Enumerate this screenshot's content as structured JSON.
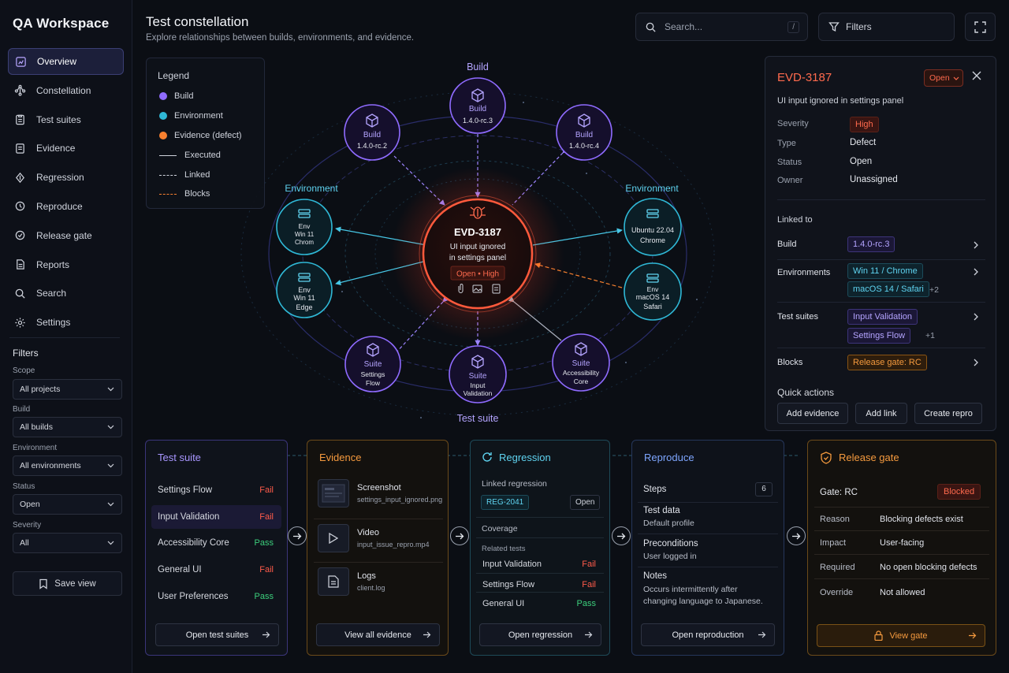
{
  "app": {
    "name": "QA Workspace"
  },
  "nav": [
    {
      "label": "Overview",
      "icon": "chart-square-icon",
      "active": true
    },
    {
      "label": "Constellation",
      "icon": "constellation-icon"
    },
    {
      "label": "Test suites",
      "icon": "clipboard-icon"
    },
    {
      "label": "Evidence",
      "icon": "folder-icon"
    },
    {
      "label": "Regression",
      "icon": "regression-icon"
    },
    {
      "label": "Reproduce",
      "icon": "reproduce-icon"
    },
    {
      "label": "Release gate",
      "icon": "gate-icon"
    },
    {
      "label": "Reports",
      "icon": "report-icon"
    },
    {
      "label": "Search",
      "icon": "search-icon"
    },
    {
      "label": "Settings",
      "icon": "gear-icon"
    }
  ],
  "filters": {
    "title": "Filters",
    "scope": {
      "label": "Scope",
      "value": "All projects"
    },
    "build": {
      "label": "Build",
      "value": "All builds"
    },
    "environment": {
      "label": "Environment",
      "value": "All environments"
    },
    "status": {
      "label": "Status",
      "value": "Open"
    },
    "severity": {
      "label": "Severity",
      "value": "All"
    },
    "save_label": "Save view"
  },
  "header": {
    "title": "Test constellation",
    "subtitle": "Explore relationships between builds, environments, and evidence.",
    "search_placeholder": "Search...",
    "search_shortcut": "/",
    "filters_label": "Filters"
  },
  "legend": {
    "title": "Legend",
    "build": "Build",
    "environment": "Environment",
    "evidence": "Evidence (defect)",
    "executed": "Executed",
    "linked": "Linked",
    "blocks": "Blocks",
    "colors": {
      "build": "#8f6bff",
      "environment": "#2fb8d6",
      "evidence": "#f7802f"
    }
  },
  "graph": {
    "group_labels": {
      "build": "Build",
      "environment_left": "Environment",
      "environment_right": "Environment",
      "suite": "Test suite"
    },
    "center": {
      "id": "EVD-3187",
      "line1": "UI input ignored",
      "line2": "in settings panel",
      "badge": "Open • High"
    },
    "nodes": {
      "build_top": {
        "type": "Build",
        "name": "1.4.0-rc.3"
      },
      "build_left": {
        "type": "Build",
        "name": "1.4.0-rc.2"
      },
      "build_right": {
        "type": "Build",
        "name": "1.4.0-rc.4"
      },
      "env_lt": {
        "line1": "Env",
        "line2": "Win 11",
        "line3": "Chrom"
      },
      "env_lb": {
        "line1": "Env",
        "line2": "Win 11",
        "line3": "Edge"
      },
      "env_rt": {
        "line1": "Ubuntu 22.04",
        "line2": "Chrome"
      },
      "env_rb": {
        "line1": "Env",
        "line2": "macOS 14",
        "line3": "Safari"
      },
      "suite_left": {
        "type": "Suite",
        "line1": "Settings",
        "line2": "Flow"
      },
      "suite_bottom": {
        "type": "Suite",
        "line1": "Input",
        "line2": "Validation"
      },
      "suite_right": {
        "type": "Suite",
        "line1": "Accessibility",
        "line2": "Core"
      }
    }
  },
  "detail": {
    "id": "EVD-3187",
    "status": "Open",
    "description": "UI input ignored in settings panel",
    "severity_label": "Severity",
    "severity": "High",
    "type_label": "Type",
    "type": "Defect",
    "status_label": "Status",
    "status_value": "Open",
    "owner_label": "Owner",
    "owner": "Unassigned",
    "linked_to": "Linked to",
    "build_label": "Build",
    "build": "1.4.0-rc.3",
    "env_label": "Environments",
    "env1": "Win 11 / Chrome",
    "env2": "macOS 14 / Safari",
    "env_more": "+2",
    "suites_label": "Test suites",
    "suite1": "Input Validation",
    "suite2": "Settings Flow",
    "suite_more": "+1",
    "blocks_label": "Blocks",
    "blocks": "Release gate: RC",
    "quick_actions": "Quick actions",
    "actions": [
      "Add evidence",
      "Add link",
      "Create repro"
    ]
  },
  "panels": {
    "test_suite": {
      "title": "Test suite",
      "rows": [
        {
          "name": "Settings Flow",
          "status": "Fail"
        },
        {
          "name": "Input Validation",
          "status": "Fail"
        },
        {
          "name": "Accessibility Core",
          "status": "Pass"
        },
        {
          "name": "General UI",
          "status": "Fail"
        },
        {
          "name": "User Preferences",
          "status": "Pass"
        }
      ],
      "button": "Open test suites"
    },
    "evidence": {
      "title": "Evidence",
      "items": [
        {
          "name": "Screenshot",
          "file": "settings_input_ignored.png"
        },
        {
          "name": "Video",
          "file": "input_issue_repro.mp4"
        },
        {
          "name": "Logs",
          "file": "client.log"
        }
      ],
      "button": "View all evidence"
    },
    "regression": {
      "title": "Regression",
      "linked_label": "Linked regression",
      "ticket": "REG-2041",
      "ticket_status": "Open",
      "coverage": "Coverage",
      "related": "Related tests",
      "rows": [
        {
          "name": "Input Validation",
          "status": "Fail"
        },
        {
          "name": "Settings Flow",
          "status": "Fail"
        },
        {
          "name": "General UI",
          "status": "Pass"
        }
      ],
      "button": "Open regression"
    },
    "reproduce": {
      "title": "Reproduce",
      "steps_label": "Steps",
      "steps": "6",
      "test_data_label": "Test data",
      "test_data": "Default profile",
      "preconditions_label": "Preconditions",
      "preconditions": "User logged in",
      "notes_label": "Notes",
      "notes_line1": "Occurs intermittently after",
      "notes_line2": "changing language to Japanese.",
      "button": "Open reproduction"
    },
    "release_gate": {
      "title": "Release gate",
      "gate": "Gate: RC",
      "gate_status": "Blocked",
      "rows": [
        {
          "k": "Reason",
          "v": "Blocking defects exist"
        },
        {
          "k": "Impact",
          "v": "User-facing"
        },
        {
          "k": "Required",
          "v": "No open blocking defects"
        },
        {
          "k": "Override",
          "v": "Not allowed"
        }
      ],
      "button": "View gate"
    }
  }
}
